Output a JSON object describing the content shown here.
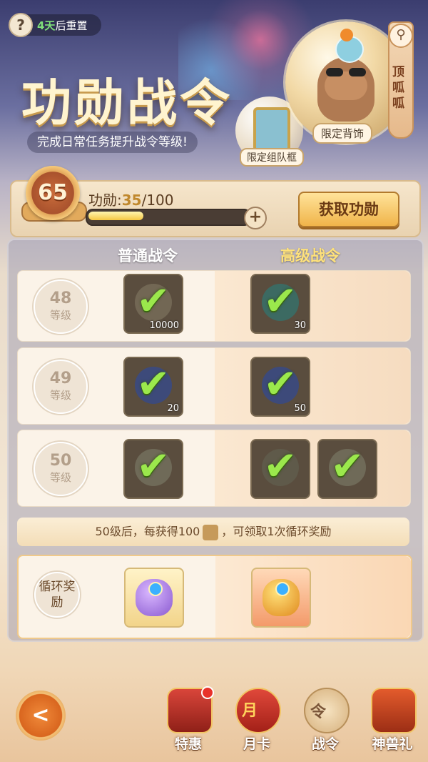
{
  "header": {
    "help_icon": "?",
    "reset_days": "4天",
    "reset_suffix": "后重置",
    "title": "功勋战令",
    "subtitle": "完成日常任务提升战令等级!",
    "reward_tags": {
      "back_ornament": "限定背饰",
      "team_frame": "限定组队框"
    },
    "side_tab": {
      "search_icon": "search-icon",
      "label": "顶呱呱"
    }
  },
  "progress": {
    "level": "65",
    "label": "功勋:",
    "current": "35",
    "max": "/100",
    "fraction": 0.35,
    "plus_label": "+",
    "get_button": "获取功勋"
  },
  "columns": {
    "normal": "普通战令",
    "premium": "高级战令"
  },
  "levels": [
    {
      "level": "48",
      "unit": "等级",
      "normal": [
        {
          "qty": "10000",
          "claimed": true
        }
      ],
      "premium": [
        {
          "qty": "30",
          "claimed": true
        }
      ]
    },
    {
      "level": "49",
      "unit": "等级",
      "normal": [
        {
          "qty": "20",
          "claimed": true
        }
      ],
      "premium": [
        {
          "qty": "50",
          "claimed": true
        }
      ]
    },
    {
      "level": "50",
      "unit": "等级",
      "normal": [
        {
          "qty": "",
          "claimed": true
        }
      ],
      "premium": [
        {
          "qty": "",
          "claimed": true
        },
        {
          "qty": "",
          "claimed": true
        }
      ]
    }
  ],
  "check_glyph": "✔",
  "hint": {
    "prefix": "50级后，每获得100",
    "suffix": "，可领取1次循环奖励"
  },
  "cycle": {
    "label": "循环奖励"
  },
  "bottom_nav": {
    "back_icon": "back-arrow-icon",
    "back_glyph": "<",
    "items": [
      {
        "label": "特惠",
        "icon": "gift-chest-icon"
      },
      {
        "label": "月卡",
        "icon": "month-card-icon",
        "glyph": "月"
      },
      {
        "label": "战令",
        "icon": "battle-pass-icon",
        "glyph": "令"
      },
      {
        "label": "神兽礼",
        "icon": "beast-gift-icon"
      }
    ]
  },
  "colors": {
    "accent": "#f0b44a",
    "check": "#9be84c",
    "premium_title": "#ffe27a"
  }
}
